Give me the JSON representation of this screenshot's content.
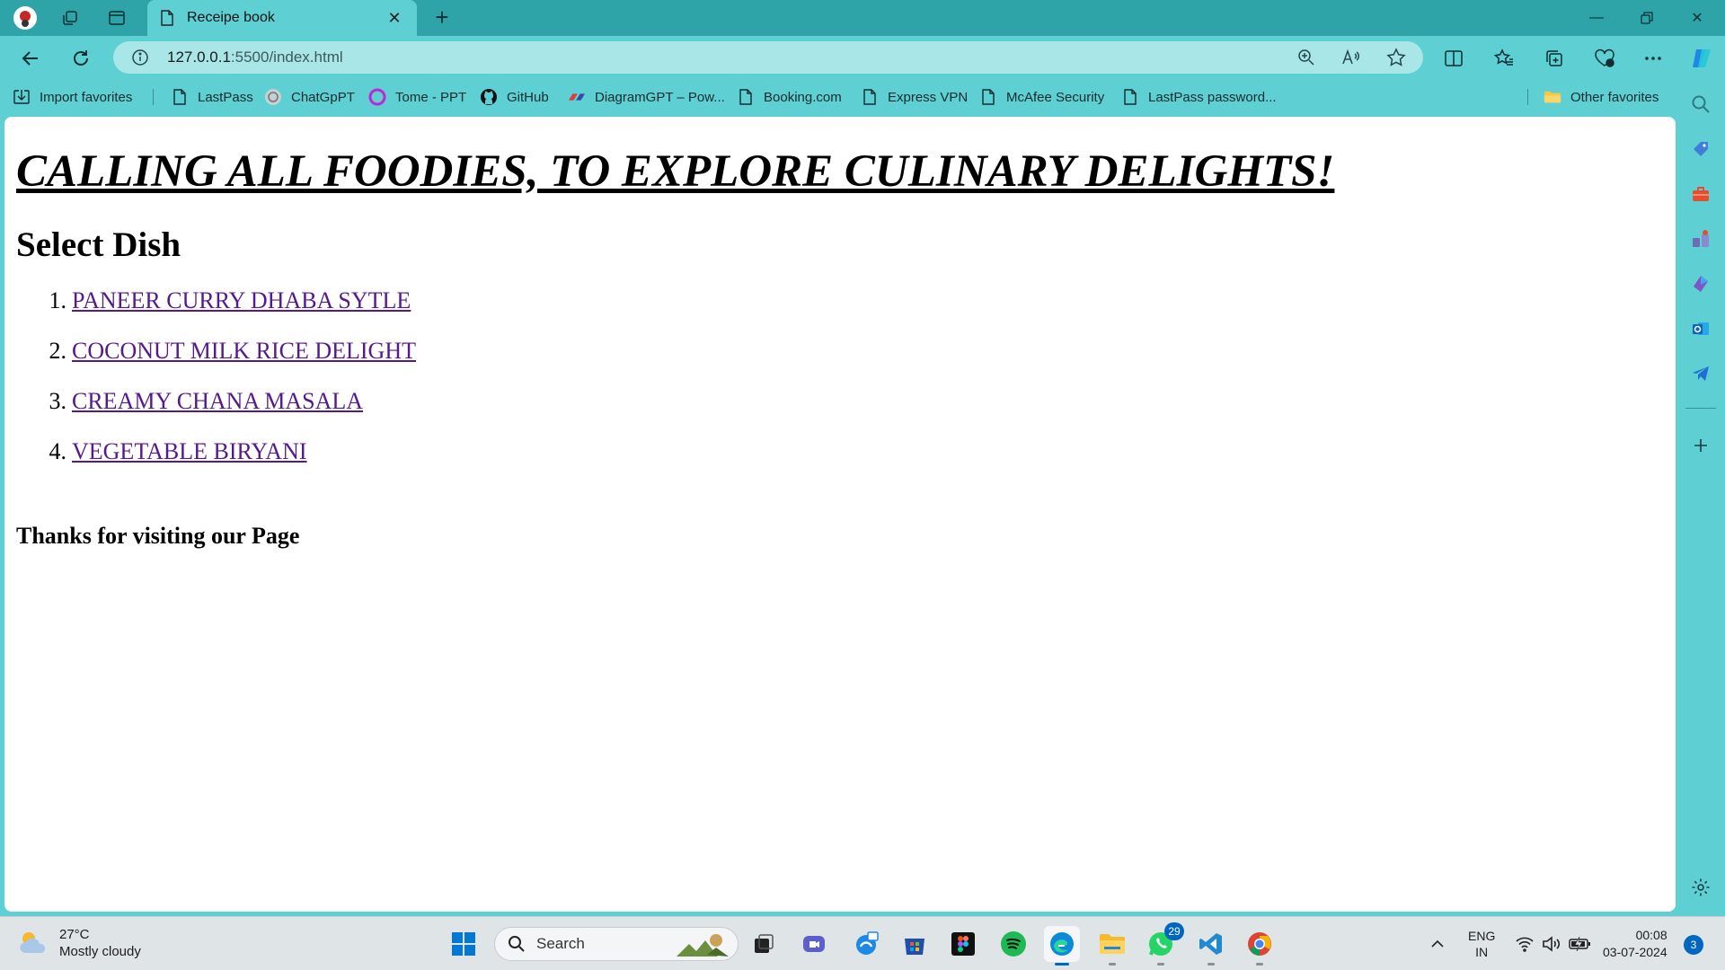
{
  "browser": {
    "tab_title": "Receipe book",
    "url_main": "127.0.0.1",
    "url_rest": ":5500/index.html"
  },
  "favorites": [
    {
      "label": "Import favorites",
      "icon": "import-icon"
    },
    {
      "label": "LastPass",
      "icon": "page-icon"
    },
    {
      "label": "ChatGpPT",
      "icon": "chatgpt-icon"
    },
    {
      "label": "Tome - PPT",
      "icon": "tome-icon"
    },
    {
      "label": "GitHub",
      "icon": "github-icon"
    },
    {
      "label": "DiagramGPT – Pow...",
      "icon": "diagramgpt-icon"
    },
    {
      "label": "Booking.com",
      "icon": "page-icon"
    },
    {
      "label": "Express VPN",
      "icon": "page-icon"
    },
    {
      "label": "McAfee Security",
      "icon": "page-icon"
    },
    {
      "label": "LastPass password...",
      "icon": "page-icon"
    }
  ],
  "other_favorites": "Other favorites",
  "page": {
    "heading": "CALLING ALL FOODIES, TO EXPLORE CULINARY DELIGHTS!",
    "select_title": "Select Dish",
    "dishes": [
      {
        "num": "1.",
        "label": "PANEER CURRY DHABA SYTLE"
      },
      {
        "num": "2.",
        "label": "COCONUT MILK RICE DELIGHT"
      },
      {
        "num": "3.",
        "label": "CREAMY CHANA MASALA"
      },
      {
        "num": "4.",
        "label": "VEGETABLE BIRYANI"
      }
    ],
    "thanks": "Thanks for visiting our Page"
  },
  "taskbar": {
    "weather_temp": "27°C",
    "weather_desc": "Mostly cloudy",
    "search_placeholder": "Search",
    "whatsapp_badge": "29",
    "lang_1": "ENG",
    "lang_2": "IN",
    "time": "00:08",
    "date": "03-07-2024",
    "notification_count": "3"
  },
  "colors": {
    "browser_frame": "#5ecfd3",
    "titlebar": "#2ea3a8",
    "visited_link": "#551a8b",
    "accent": "#0067c0"
  }
}
